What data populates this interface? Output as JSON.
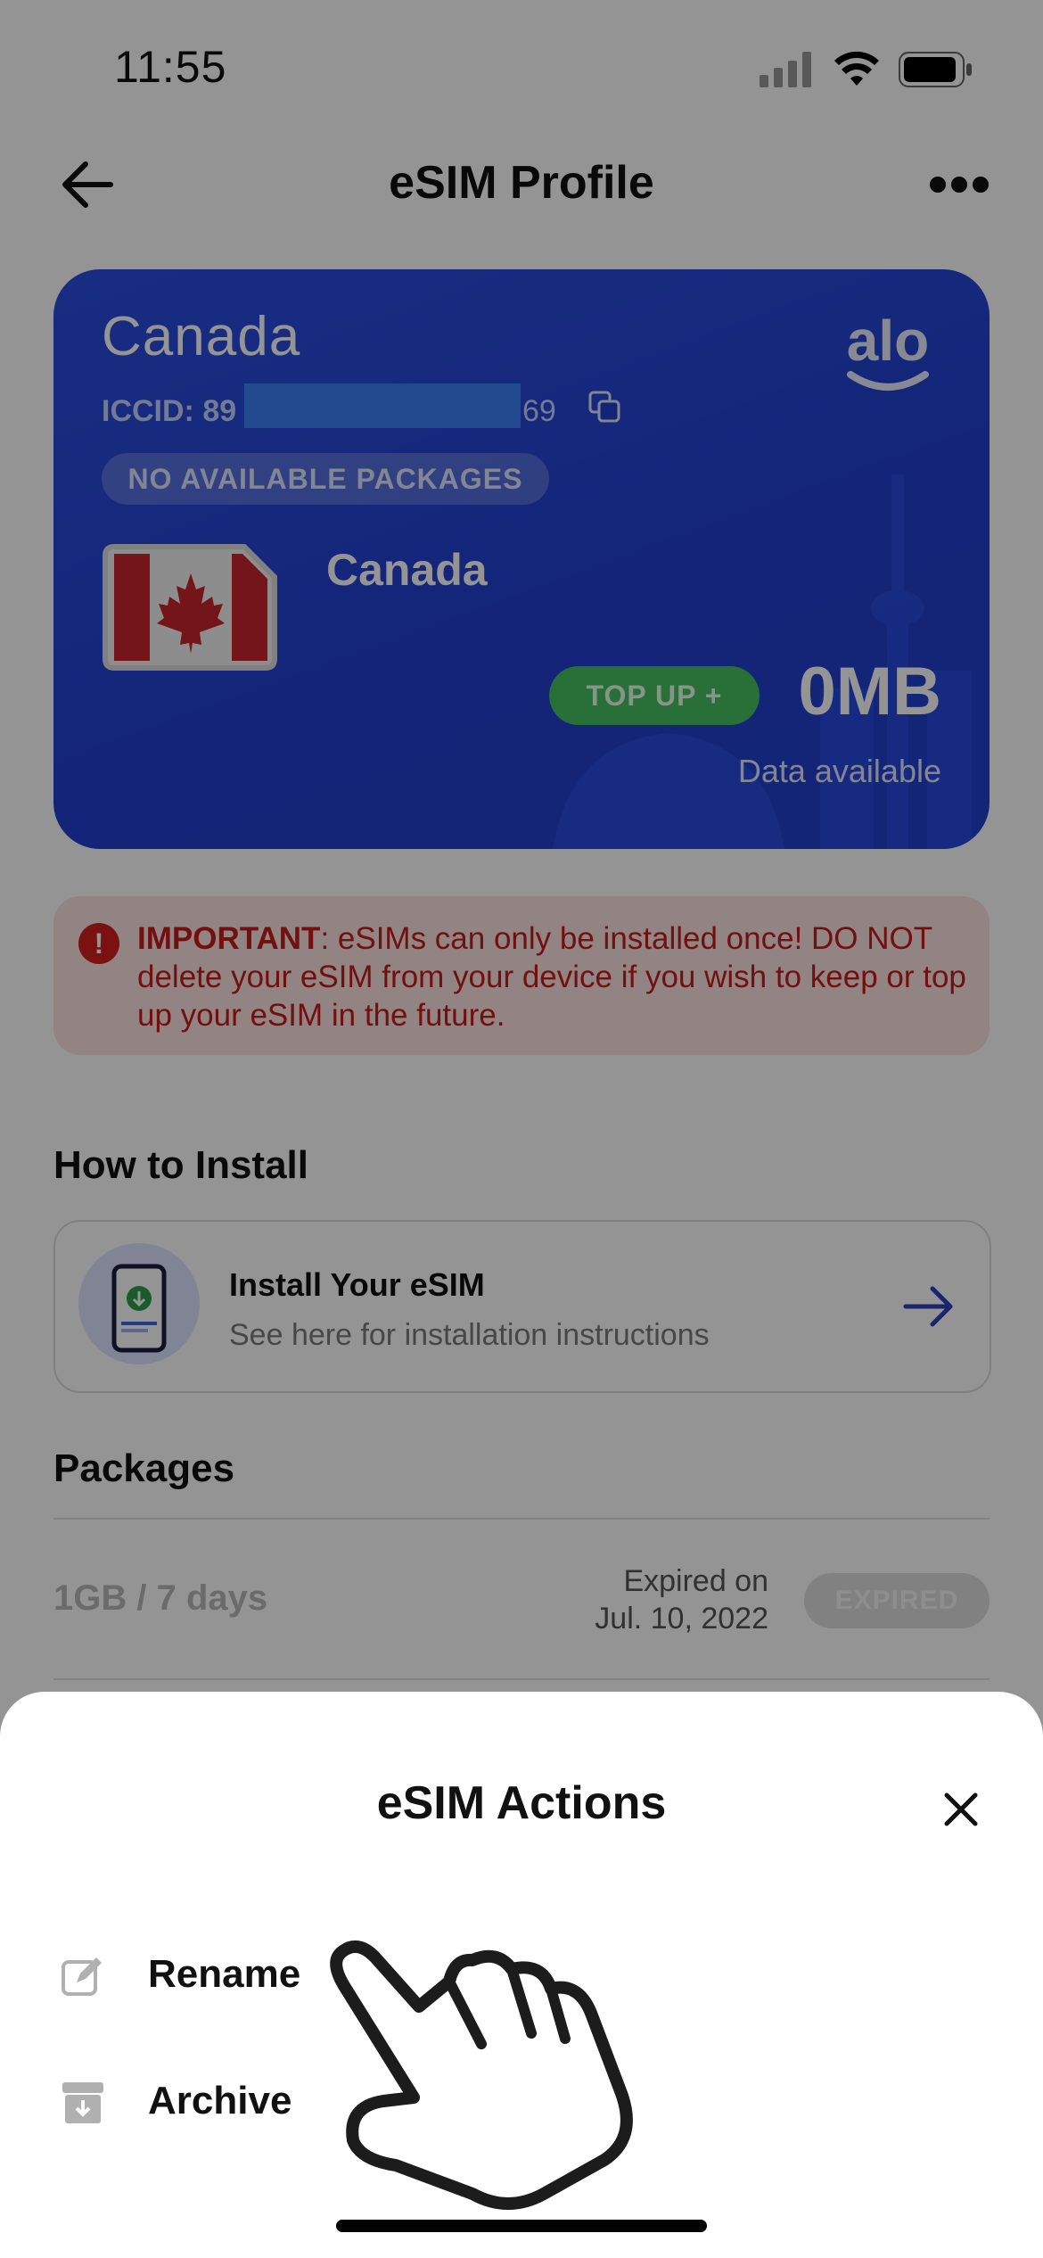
{
  "status_bar": {
    "time": "11:55"
  },
  "nav": {
    "title": "eSIM Profile"
  },
  "card": {
    "country": "Canada",
    "iccid_prefix": "ICCID: 89",
    "iccid_suffix": "69",
    "no_packages": "NO AVAILABLE PACKAGES",
    "network_name": "Canada",
    "brand": "alo",
    "top_up_label": "TOP UP +",
    "data_value": "0MB",
    "data_label": "Data available"
  },
  "alert": {
    "label": "IMPORTANT",
    "message": ": eSIMs can only be installed once! DO NOT delete your eSIM from your device if you wish to keep or top up your eSIM in the future."
  },
  "install_section": {
    "heading": "How to Install",
    "card_title": "Install Your eSIM",
    "card_subtitle": "See here for installation instructions"
  },
  "packages_section": {
    "heading": "Packages",
    "items": [
      {
        "name": "1GB / 7 days",
        "expiry_line1": "Expired on",
        "expiry_line2": "Jul. 10, 2022",
        "status": "EXPIRED"
      }
    ]
  },
  "sheet": {
    "title": "eSIM Actions",
    "actions": [
      {
        "label": "Rename",
        "icon": "edit-icon"
      },
      {
        "label": "Archive",
        "icon": "archive-icon"
      }
    ]
  },
  "colors": {
    "card_blue": "#2341d1",
    "topup_green": "#45c061",
    "alert_red": "#c51d1d",
    "alert_bg": "#fbe3e0"
  }
}
